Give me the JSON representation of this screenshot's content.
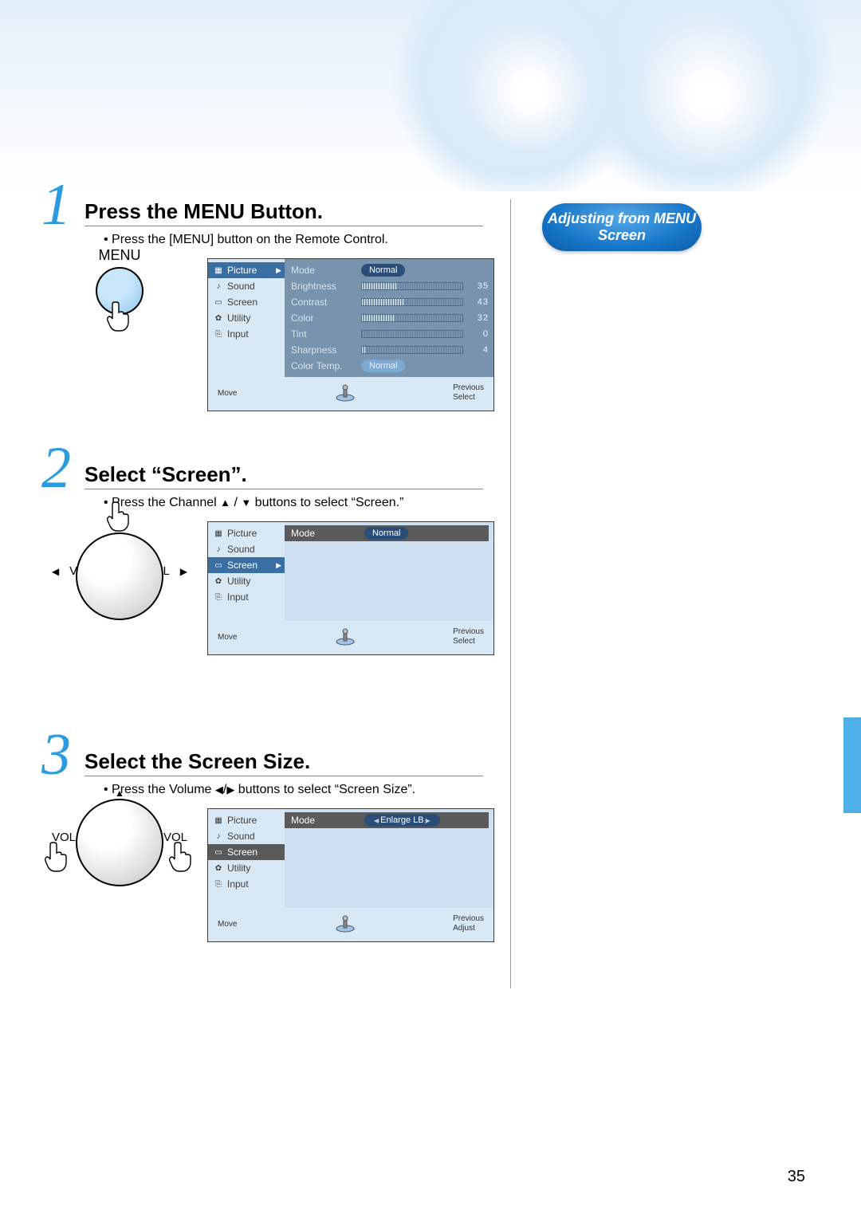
{
  "page_number": "35",
  "callout": "Adjusting from MENU Screen",
  "steps": [
    {
      "num": "1",
      "title": "Press the MENU Button.",
      "desc_pre": "• Press the [MENU] button on the Remote Control.",
      "remote_label": "MENU"
    },
    {
      "num": "2",
      "title": "Select “Screen”.",
      "desc_pre": "• Press the Channel ",
      "desc_mid": " / ",
      "desc_post": " buttons to select “Screen.”",
      "vol_left": "VOL",
      "vol_right": "VOL"
    },
    {
      "num": "3",
      "title": "Select the Screen Size.",
      "desc_pre": "• Press the Volume ",
      "desc_mid": "/",
      "desc_post": " buttons to select “Screen Size”.",
      "vol_left": "VOL",
      "vol_right": "VOL"
    }
  ],
  "osd_common": {
    "footer_move": "Move",
    "footer_previous": "Previous",
    "footer_select": "Select",
    "footer_adjust": "Adjust"
  },
  "osd1": {
    "menu": [
      "Picture",
      "Sound",
      "Screen",
      "Utility",
      "Input"
    ],
    "selected_index": 0,
    "params": [
      {
        "label": "Mode",
        "type": "pill",
        "value": "Normal"
      },
      {
        "label": "Brightness",
        "type": "bar",
        "value": "35",
        "pct": 35
      },
      {
        "label": "Contrast",
        "type": "bar",
        "value": "43",
        "pct": 43
      },
      {
        "label": "Color",
        "type": "bar",
        "value": "32",
        "pct": 32
      },
      {
        "label": "Tint",
        "type": "bar",
        "value": "0",
        "pct": 0
      },
      {
        "label": "Sharpness",
        "type": "bar",
        "value": "4",
        "pct": 4
      },
      {
        "label": "Color Temp.",
        "type": "pill_light",
        "value": "Normal"
      }
    ]
  },
  "osd2": {
    "menu": [
      "Picture",
      "Sound",
      "Screen",
      "Utility",
      "Input"
    ],
    "selected_index": 2,
    "mode_label": "Mode",
    "mode_value": "Normal"
  },
  "osd3": {
    "menu": [
      "Picture",
      "Sound",
      "Screen",
      "Utility",
      "Input"
    ],
    "selected_index": 2,
    "mode_label": "Mode",
    "mode_value": "Enlarge LB"
  }
}
